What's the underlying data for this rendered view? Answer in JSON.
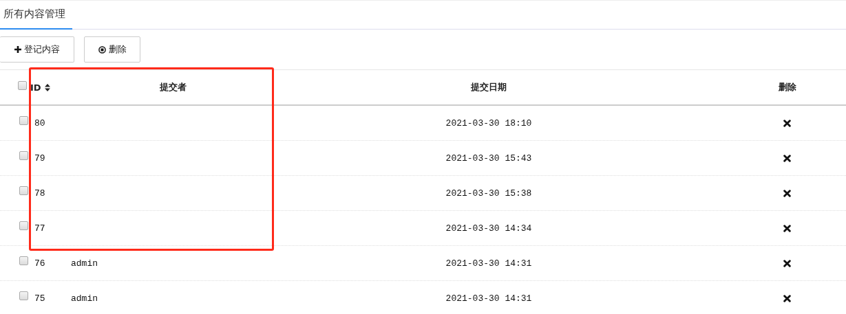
{
  "tabs": [
    {
      "label": "所有内容管理",
      "selected": true
    }
  ],
  "toolbar": [
    {
      "kind": "add",
      "label": "登记内容"
    },
    {
      "kind": "delete",
      "label": "删除"
    }
  ],
  "table": {
    "select_all": {
      "checked": false
    },
    "columns": [
      "ID",
      "提交者",
      "提交日期",
      "删除"
    ],
    "rows": [
      {
        "checked": false,
        "id": "80",
        "submitter": "",
        "date": "2021-03-30 18:10"
      },
      {
        "checked": false,
        "id": "79",
        "submitter": "",
        "date": "2021-03-30 15:43"
      },
      {
        "checked": false,
        "id": "78",
        "submitter": "",
        "date": "2021-03-30 15:38"
      },
      {
        "checked": false,
        "id": "77",
        "submitter": "",
        "date": "2021-03-30 14:34"
      },
      {
        "checked": false,
        "id": "76",
        "submitter": "admin",
        "date": "2021-03-30 14:31"
      },
      {
        "checked": false,
        "id": "75",
        "submitter": "admin",
        "date": "2021-03-30 14:31"
      }
    ]
  },
  "annotation": {
    "kind": "rectangle"
  }
}
